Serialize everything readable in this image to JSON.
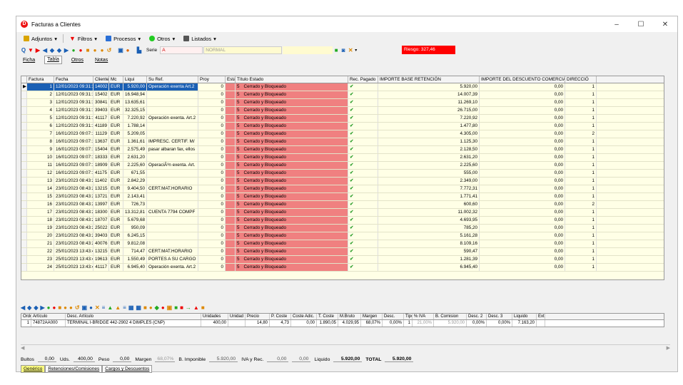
{
  "window": {
    "title": "Facturas a Clientes",
    "app_icon": "D",
    "controls": [
      "–",
      "☐",
      "✕"
    ]
  },
  "toolbar1": [
    "Adjuntos",
    "Filtros",
    "Procesos",
    "Otros",
    "Listados"
  ],
  "toolbar2": {
    "serie_label": "Serie",
    "serie_value": "A",
    "normal": "NORMAL",
    "riesgo": "Riesgo: 327,46"
  },
  "tabs": [
    "Ficha",
    "Tabla",
    "Otros",
    "Notas"
  ],
  "columns": [
    "Factura",
    "Fecha",
    "Cliente",
    "Mc",
    "Liqui",
    "Su Ref.",
    "Proy",
    "Estado",
    "Título Estado",
    "Rec. Pagado",
    "IMPORTE BASE RETENCIÓN",
    "IMPORTE DEL DESCUENTO COMERCIAL",
    "DIRECCIÓ"
  ],
  "rows": [
    [
      "1",
      "12/01/2023 09:31:13",
      "14002",
      "EUR",
      "5.920,00",
      "Operación exenta Art.2",
      "0",
      "5",
      "Cerrado y Bloqueado",
      "5.920,00",
      "0,00",
      "1"
    ],
    [
      "2",
      "12/01/2023 09:31:14",
      "15402",
      "EUR",
      "16.948,94",
      "",
      "0",
      "5",
      "Cerrado y Bloqueado",
      "14.007,39",
      "0,00",
      "1"
    ],
    [
      "3",
      "12/01/2023 09:31:14",
      "30841",
      "EUR",
      "13.635,61",
      "",
      "0",
      "5",
      "Cerrado y Bloqueado",
      "11.269,10",
      "0,00",
      "1"
    ],
    [
      "4",
      "12/01/2023 09:31:14",
      "39403",
      "EUR",
      "32.325,15",
      "",
      "0",
      "5",
      "Cerrado y Bloqueado",
      "26.715,00",
      "0,00",
      "1"
    ],
    [
      "5",
      "12/01/2023 09:31:15",
      "41117",
      "EUR",
      "7.220,92",
      "Operación exenta. Art.2",
      "0",
      "5",
      "Cerrado y Bloqueado",
      "7.220,92",
      "0,00",
      "1"
    ],
    [
      "6",
      "12/01/2023 09:31:15",
      "41189",
      "EUR",
      "1.788,14",
      "",
      "0",
      "5",
      "Cerrado y Bloqueado",
      "1.477,80",
      "0,00",
      "1"
    ],
    [
      "7",
      "16/01/2023 09:07:13",
      "11129",
      "EUR",
      "5.209,05",
      "",
      "0",
      "5",
      "Cerrado y Bloqueado",
      "4.305,00",
      "0,00",
      "2"
    ],
    [
      "8",
      "16/01/2023 09:07:13",
      "13637",
      "EUR",
      "1.361,61",
      "IMPRESC. CERTIF. M/",
      "0",
      "5",
      "Cerrado y Bloqueado",
      "1.125,30",
      "0,00",
      "1"
    ],
    [
      "9",
      "16/01/2023 09:07:14",
      "15404",
      "EUR",
      "2.575,49",
      "pasar albaran fax, ellos",
      "0",
      "5",
      "Cerrado y Bloqueado",
      "2.128,50",
      "0,00",
      "1"
    ],
    [
      "10",
      "16/01/2023 09:07:14",
      "18333",
      "EUR",
      "2.631,20",
      "",
      "0",
      "5",
      "Cerrado y Bloqueado",
      "2.631,20",
      "0,00",
      "1"
    ],
    [
      "11",
      "16/01/2023 09:07:14",
      "18909",
      "EUR",
      "2.225,60",
      "OperaciÃ³n exenta. Art.",
      "0",
      "5",
      "Cerrado y Bloqueado",
      "2.225,60",
      "0,00",
      "1"
    ],
    [
      "12",
      "16/01/2023 09:07:14",
      "41175",
      "EUR",
      "671,55",
      "",
      "0",
      "5",
      "Cerrado y Bloqueado",
      "555,00",
      "0,00",
      "1"
    ],
    [
      "13",
      "23/01/2023 08:43:20",
      "11402",
      "EUR",
      "2.842,29",
      "",
      "0",
      "5",
      "Cerrado y Bloqueado",
      "2.349,00",
      "0,00",
      "1"
    ],
    [
      "14",
      "23/01/2023 08:43:20",
      "13215",
      "EUR",
      "9.404,50",
      "CERT.MAT.HORARIO",
      "0",
      "5",
      "Cerrado y Bloqueado",
      "7.772,31",
      "0,00",
      "1"
    ],
    [
      "15",
      "23/01/2023 08:43:21",
      "13721",
      "EUR",
      "2.143,41",
      "",
      "0",
      "5",
      "Cerrado y Bloqueado",
      "1.771,41",
      "0,00",
      "1"
    ],
    [
      "16",
      "23/01/2023 08:43:21",
      "13997",
      "EUR",
      "726,73",
      "",
      "0",
      "5",
      "Cerrado y Bloqueado",
      "600,60",
      "0,00",
      "2"
    ],
    [
      "17",
      "23/01/2023 08:43:21",
      "18300",
      "EUR",
      "13.312,81",
      "CUENTA 7794 COMPF",
      "0",
      "5",
      "Cerrado y Bloqueado",
      "11.002,32",
      "0,00",
      "1"
    ],
    [
      "18",
      "23/01/2023 08:43:21",
      "18707",
      "EUR",
      "5.679,68",
      "",
      "0",
      "5",
      "Cerrado y Bloqueado",
      "4.693,95",
      "0,00",
      "1"
    ],
    [
      "19",
      "23/01/2023 08:43:21",
      "25022",
      "EUR",
      "950,09",
      "",
      "0",
      "5",
      "Cerrado y Bloqueado",
      "785,20",
      "0,00",
      "1"
    ],
    [
      "20",
      "23/01/2023 08:43:21",
      "39403",
      "EUR",
      "6.245,15",
      "",
      "0",
      "5",
      "Cerrado y Bloqueado",
      "5.161,28",
      "0,00",
      "1"
    ],
    [
      "21",
      "23/01/2023 08:43:22",
      "40076",
      "EUR",
      "9.812,08",
      "",
      "0",
      "5",
      "Cerrado y Bloqueado",
      "8.109,16",
      "0,00",
      "1"
    ],
    [
      "22",
      "25/01/2023 13:43:49",
      "13215",
      "EUR",
      "714,47",
      "CERT.MAT.HORARIO",
      "0",
      "5",
      "Cerrado y Bloqueado",
      "590,47",
      "0,00",
      "1"
    ],
    [
      "23",
      "25/01/2023 13:43:49",
      "19613",
      "EUR",
      "1.550,49",
      "PORTES A SU CARGO",
      "0",
      "5",
      "Cerrado y Bloqueado",
      "1.281,39",
      "0,00",
      "1"
    ],
    [
      "24",
      "25/01/2023 13:43:49",
      "41117",
      "EUR",
      "6.945,40",
      "Operación exenta. Art.2",
      "0",
      "5",
      "Cerrado y Bloqueado",
      "6.945,40",
      "0,00",
      "1"
    ]
  ],
  "detail": {
    "columns": [
      "Orden",
      "Artículo",
      "Desc. Artículo",
      "Unidades",
      "Unidad",
      "Precio",
      "P. Coste",
      "Coste Adic.",
      "T. Coste",
      "M.Bruto",
      "Margen",
      "Desc.",
      "Tipo IVA",
      "% IVA",
      "B. Comision",
      "Desc. 2",
      "Desc. 3",
      "Liquido",
      "Ext."
    ],
    "row": [
      "1",
      "74872AA000",
      "TERMINAL I-BRIDGE 442-2902 4 DIMPLES  (CNP)",
      "400,00",
      "",
      "14,80",
      "4,73",
      "0,00",
      "1.890,05",
      "4.029,95",
      "68,07%",
      "0,00%",
      "1",
      "21,00%",
      "5.920,00",
      "0,00%",
      "0,00%",
      "7.163,20",
      ""
    ]
  },
  "totals": {
    "bultos_label": "Bultos",
    "bultos": "0,00",
    "uds_label": "Uds.",
    "uds": "400,00",
    "peso_label": "Peso",
    "peso": "0,00",
    "margen_label": "Margen",
    "margen": "68,07%",
    "bimp_label": "B. Imponible",
    "bimp": "5.920,00",
    "ivarec_label": "IVA y Rec.",
    "ivarec": "0,00",
    "x": "0,00",
    "liquido_label": "Liquido",
    "liquido": "5.920,00",
    "total_label": "TOTAL",
    "total": "5.920,00"
  },
  "bottom_tabs": [
    "Genérico",
    "Retenciones/Comisiones",
    "Cargos y Descuentos"
  ]
}
